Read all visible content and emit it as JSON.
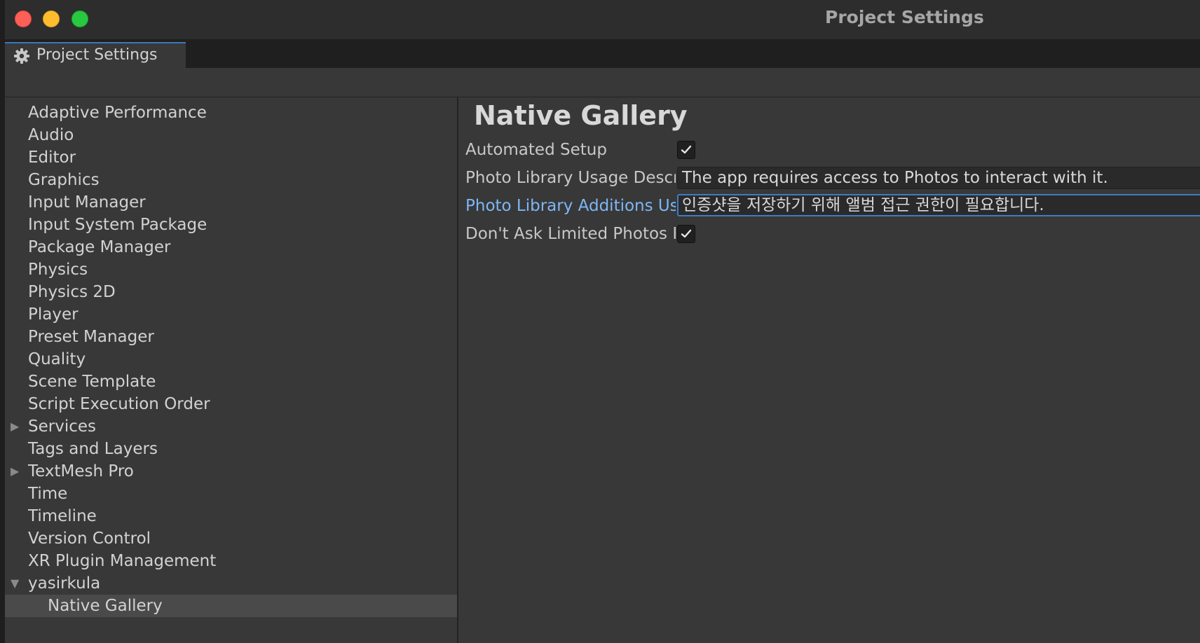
{
  "window": {
    "title": "Project Settings"
  },
  "tab": {
    "label": "Project Settings",
    "icon": "gear-icon"
  },
  "sidebar": {
    "items": [
      {
        "label": "Adaptive Performance"
      },
      {
        "label": "Audio"
      },
      {
        "label": "Editor"
      },
      {
        "label": "Graphics"
      },
      {
        "label": "Input Manager"
      },
      {
        "label": "Input System Package"
      },
      {
        "label": "Package Manager"
      },
      {
        "label": "Physics"
      },
      {
        "label": "Physics 2D"
      },
      {
        "label": "Player"
      },
      {
        "label": "Preset Manager"
      },
      {
        "label": "Quality"
      },
      {
        "label": "Scene Template"
      },
      {
        "label": "Script Execution Order"
      },
      {
        "label": "Services",
        "expander": "collapsed"
      },
      {
        "label": "Tags and Layers"
      },
      {
        "label": "TextMesh Pro",
        "expander": "collapsed"
      },
      {
        "label": "Time"
      },
      {
        "label": "Timeline"
      },
      {
        "label": "Version Control"
      },
      {
        "label": "XR Plugin Management"
      },
      {
        "label": "yasirkula",
        "expander": "expanded"
      },
      {
        "label": "Native Gallery",
        "selected": true
      }
    ]
  },
  "content": {
    "title": "Native Gallery",
    "fields": {
      "automated_setup": {
        "label": "Automated Setup",
        "checked": true
      },
      "usage_description": {
        "label": "Photo Library Usage Descr",
        "value": "The app requires access to Photos to interact with it."
      },
      "additions_usage": {
        "label": "Photo Library Additions Us",
        "value": "인증샷을 저장하기 위해 앨범 접근 권한이 필요합니다."
      },
      "dont_ask_limited": {
        "label": "Don't Ask Limited Photos P",
        "checked": true
      }
    }
  },
  "colors": {
    "accent": "#3a79bb",
    "focused_label": "#7eb6f5",
    "close": "#fe5f57",
    "minimize": "#febc2e",
    "zoom": "#28c840"
  }
}
